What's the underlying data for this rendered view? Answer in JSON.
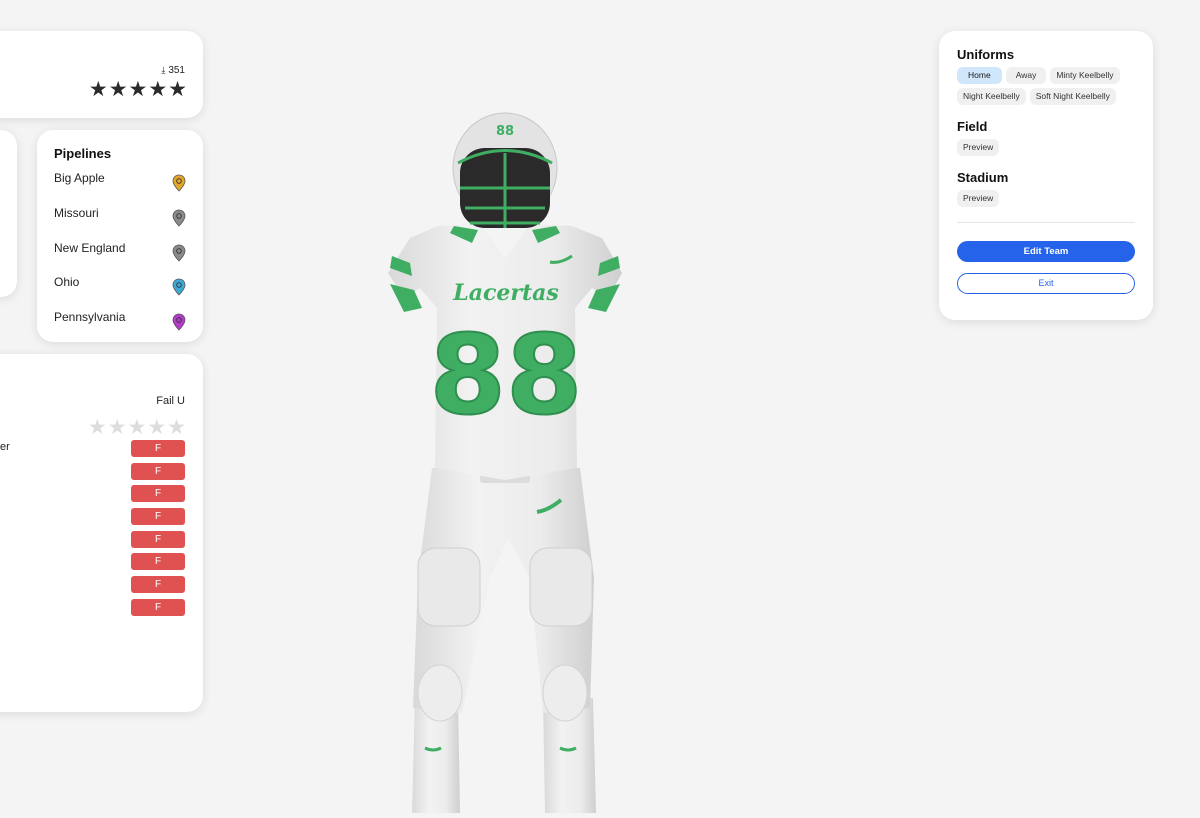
{
  "top_card": {
    "downloads": "351",
    "rating": 5
  },
  "pipelines": {
    "title": "Pipelines",
    "items": [
      {
        "label": "Big Apple",
        "color": "#e2a62b"
      },
      {
        "label": "Missouri",
        "color": "#8a8a8a"
      },
      {
        "label": "New England",
        "color": "#8a8a8a"
      },
      {
        "label": "Ohio",
        "color": "#3fa9d6"
      },
      {
        "label": "Pennsylvania",
        "color": "#b43cc8"
      }
    ]
  },
  "grades_card": {
    "school": "Fail U",
    "rating": 0,
    "row_label_fragment": "er",
    "grades": [
      "F",
      "F",
      "F",
      "F",
      "F",
      "F",
      "F",
      "F"
    ]
  },
  "player": {
    "jersey_number": "88",
    "wordmark": "Lacertas",
    "helmet_number": "88",
    "accent_color": "#3fae63"
  },
  "right_panel": {
    "uniforms_title": "Uniforms",
    "uniforms": [
      {
        "label": "Home",
        "active": true
      },
      {
        "label": "Away",
        "active": false
      },
      {
        "label": "Minty Keelbelly",
        "active": false
      },
      {
        "label": "Night Keelbelly",
        "active": false
      },
      {
        "label": "Soft Night Keelbelly",
        "active": false
      }
    ],
    "field_title": "Field",
    "field_preview": "Preview",
    "stadium_title": "Stadium",
    "stadium_preview": "Preview",
    "edit_team": "Edit Team",
    "exit": "Exit"
  },
  "colors": {
    "primary_blue": "#2563eb",
    "grade_red": "#e05252",
    "chip_active": "#cfe6fb"
  }
}
